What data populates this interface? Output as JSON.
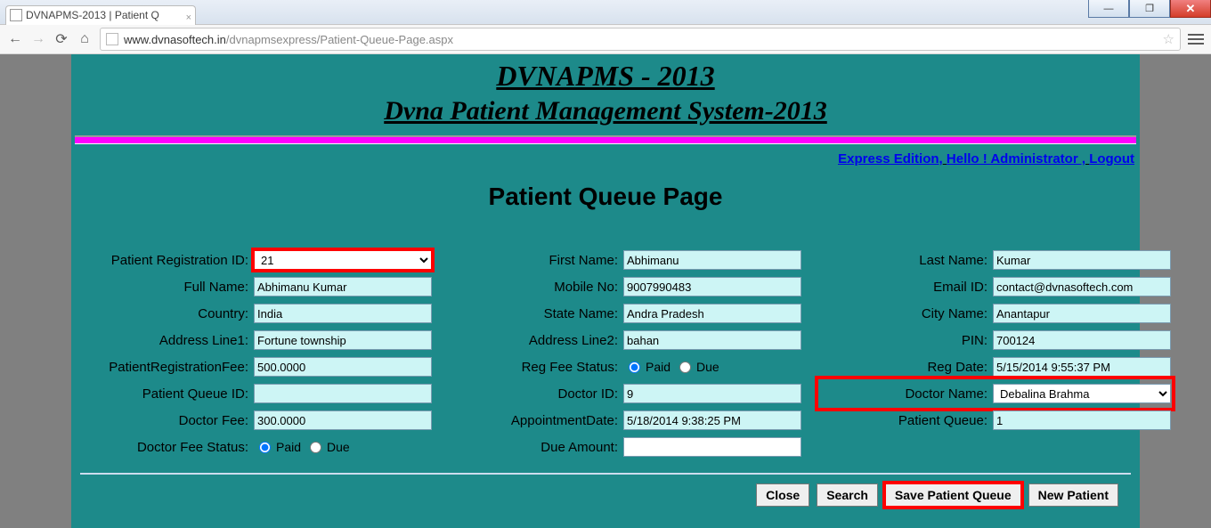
{
  "browser": {
    "tab_title": "DVNAPMS-2013 | Patient Q",
    "url_host": "www.dvnasoftech.in",
    "url_path": "/dvnapmsexpress/Patient-Queue-Page.aspx"
  },
  "header": {
    "title1": "DVNAPMS - 2013",
    "title2": "Dvna Patient Management System-2013",
    "login_edition": "Express Edition,",
    "login_hello": "Hello ! Administrator ,",
    "login_logout": "Logout"
  },
  "page_title": "Patient Queue Page",
  "labels": {
    "patient_reg_id": "Patient Registration ID:",
    "first_name": "First Name:",
    "last_name": "Last Name:",
    "full_name": "Full Name:",
    "mobile_no": "Mobile No:",
    "email_id": "Email ID:",
    "country": "Country:",
    "state_name": "State Name:",
    "city_name": "City Name:",
    "address1": "Address Line1:",
    "address2": "Address Line2:",
    "pin": "PIN:",
    "reg_fee": "PatientRegistrationFee:",
    "reg_fee_status": "Reg Fee Status:",
    "reg_date": "Reg Date:",
    "patient_queue_id": "Patient Queue ID:",
    "doctor_id": "Doctor ID:",
    "doctor_name": "Doctor Name:",
    "doctor_fee": "Doctor Fee:",
    "appointment_date": "AppointmentDate:",
    "patient_queue": "Patient Queue:",
    "doctor_fee_status": "Doctor Fee Status:",
    "due_amount": "Due Amount:",
    "paid": "Paid",
    "due": "Due"
  },
  "values": {
    "patient_reg_id": "21",
    "first_name": "Abhimanu",
    "last_name": "Kumar",
    "full_name": "Abhimanu Kumar",
    "mobile_no": "9007990483",
    "email_id": "contact@dvnasoftech.com",
    "country": "India",
    "state_name": "Andra Pradesh",
    "city_name": "Anantapur",
    "address1": "Fortune township",
    "address2": "bahan",
    "pin": "700124",
    "reg_fee": "500.0000",
    "reg_date": "5/15/2014 9:55:37 PM",
    "patient_queue_id": "",
    "doctor_id": "9",
    "doctor_name": "Debalina Brahma",
    "doctor_fee": "300.0000",
    "appointment_date": "5/18/2014 9:38:25 PM",
    "patient_queue": "1",
    "due_amount": ""
  },
  "buttons": {
    "close": "Close",
    "search": "Search",
    "save": "Save Patient Queue",
    "new_patient": "New Patient"
  }
}
